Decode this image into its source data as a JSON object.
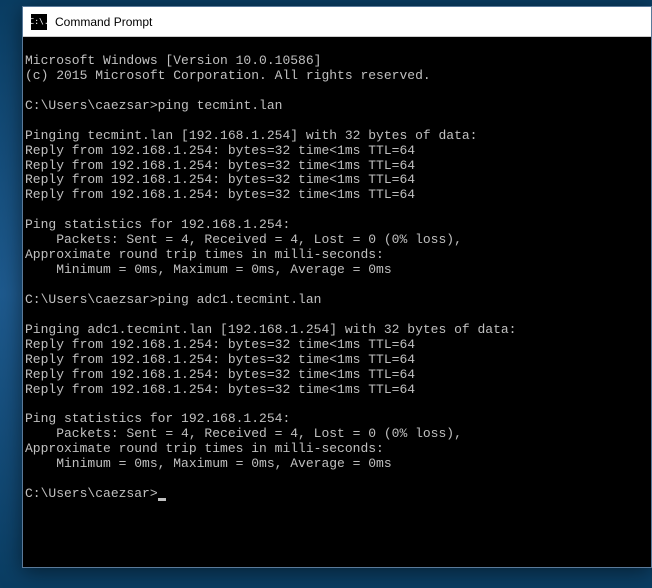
{
  "window": {
    "title": "Command Prompt",
    "icon_text": "C:\\."
  },
  "terminal": {
    "header1": "Microsoft Windows [Version 10.0.10586]",
    "header2": "(c) 2015 Microsoft Corporation. All rights reserved.",
    "prompt1_path": "C:\\Users\\caezsar>",
    "prompt1_cmd": "ping tecmint.lan",
    "ping1": {
      "header": "Pinging tecmint.lan [192.168.1.254] with 32 bytes of data:",
      "reply1": "Reply from 192.168.1.254: bytes=32 time<1ms TTL=64",
      "reply2": "Reply from 192.168.1.254: bytes=32 time<1ms TTL=64",
      "reply3": "Reply from 192.168.1.254: bytes=32 time<1ms TTL=64",
      "reply4": "Reply from 192.168.1.254: bytes=32 time<1ms TTL=64",
      "stats_header": "Ping statistics for 192.168.1.254:",
      "stats_packets": "    Packets: Sent = 4, Received = 4, Lost = 0 (0% loss),",
      "rtt_header": "Approximate round trip times in milli-seconds:",
      "rtt_values": "    Minimum = 0ms, Maximum = 0ms, Average = 0ms"
    },
    "prompt2_path": "C:\\Users\\caezsar>",
    "prompt2_cmd": "ping adc1.tecmint.lan",
    "ping2": {
      "header": "Pinging adc1.tecmint.lan [192.168.1.254] with 32 bytes of data:",
      "reply1": "Reply from 192.168.1.254: bytes=32 time<1ms TTL=64",
      "reply2": "Reply from 192.168.1.254: bytes=32 time<1ms TTL=64",
      "reply3": "Reply from 192.168.1.254: bytes=32 time<1ms TTL=64",
      "reply4": "Reply from 192.168.1.254: bytes=32 time<1ms TTL=64",
      "stats_header": "Ping statistics for 192.168.1.254:",
      "stats_packets": "    Packets: Sent = 4, Received = 4, Lost = 0 (0% loss),",
      "rtt_header": "Approximate round trip times in milli-seconds:",
      "rtt_values": "    Minimum = 0ms, Maximum = 0ms, Average = 0ms"
    },
    "prompt3_path": "C:\\Users\\caezsar>"
  }
}
